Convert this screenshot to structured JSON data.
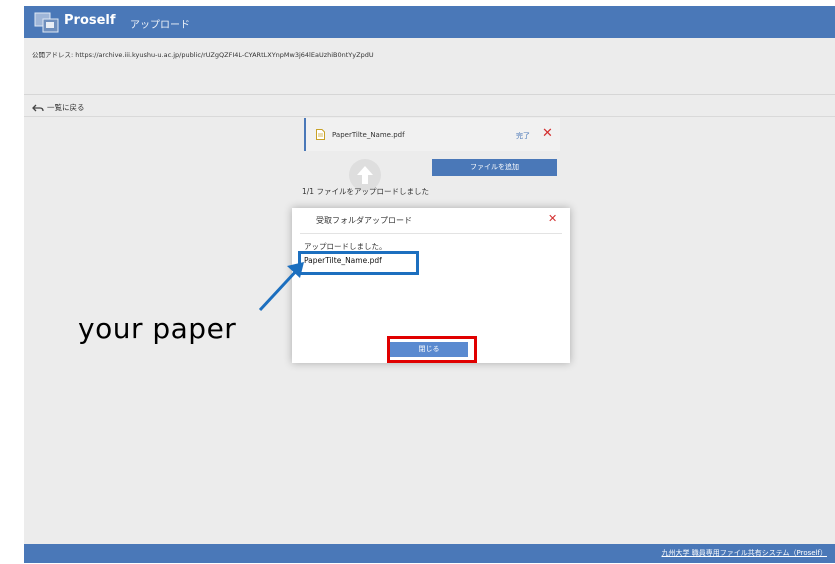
{
  "header": {
    "app_name": "Proself",
    "page_tab": "アップロード",
    "logo_icon": "proself-logo-icon"
  },
  "address": {
    "text": "公開アドレス: https://archive.iii.kyushu-u.ac.jp/public/rUZgQZFI4L-CYARtLXYnpMw3j64lEaUzhiB0ntYyZpdU"
  },
  "nav": {
    "back_label": "一覧に戻る",
    "back_icon": "back-arrow-icon"
  },
  "upload_list": {
    "file_name": "PaperTilte_Name.pdf",
    "status_done": "完了",
    "remove_symbol": "✕",
    "add_file_label": "ファイルを追加",
    "status_text": "1/1 ファイルをアップロードしました"
  },
  "modal": {
    "title": "受取フォルダアップロード",
    "close_symbol": "✕",
    "message": "アップロードしました。",
    "file_name": "PaperTilte_Name.pdf",
    "close_button": "閉じる"
  },
  "annotation": {
    "label": "your paper",
    "arrow_color": "#1c6fbf",
    "highlight_blue": "#1c6fbf",
    "highlight_red": "#e00000"
  },
  "footer": {
    "link": "九州大学 職員専用ファイル共有システム（Proself）"
  },
  "colors": {
    "brand": "#4a78b8",
    "background": "#ececec",
    "danger": "#d32f2f"
  }
}
